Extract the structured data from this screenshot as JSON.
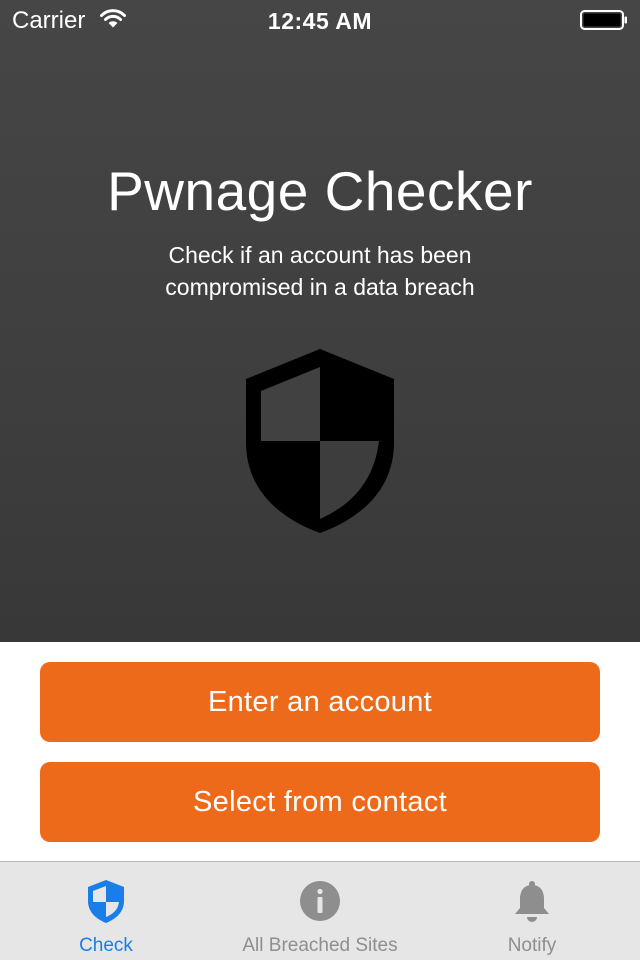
{
  "status_bar": {
    "carrier": "Carrier",
    "time": "12:45 AM"
  },
  "hero": {
    "title": "Pwnage Checker",
    "subtitle": "Check if an account has been compromised in a data breach",
    "icon": "shield-icon"
  },
  "actions": {
    "enter_account_label": "Enter an account",
    "select_contact_label": "Select from contact"
  },
  "tabbar": {
    "selected": "Check",
    "tabs": [
      {
        "label": "Check",
        "icon": "shield-icon"
      },
      {
        "label": "All Breached Sites",
        "icon": "info-icon"
      },
      {
        "label": "Notify",
        "icon": "bell-icon"
      }
    ]
  },
  "colors": {
    "accent_orange": "#ee6a1b",
    "tab_selected": "#1a7ee8",
    "tab_unselected": "#8e8e8e",
    "hero_background": "#414141"
  }
}
